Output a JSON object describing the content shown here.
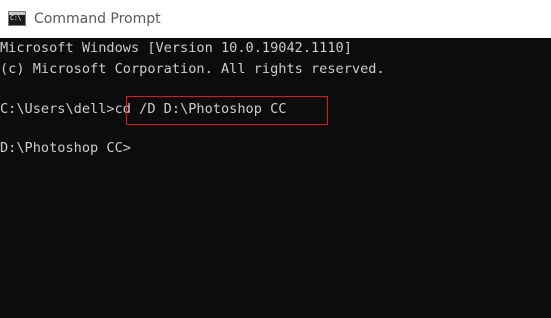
{
  "window": {
    "title": "Command Prompt",
    "icon": "cmd-icon",
    "icon_glyph": "C:\\"
  },
  "console": {
    "lines": [
      "Microsoft Windows [Version 10.0.19042.1110]",
      "(c) Microsoft Corporation. All rights reserved.",
      "C:\\Users\\dell>",
      "D:\\Photoshop CC>"
    ],
    "command": "cd /D D:\\Photoshop CC"
  },
  "colors": {
    "background": "#0c0c0c",
    "text": "#cccccc",
    "titlebar": "#ffffff",
    "highlight": "#e0161b"
  }
}
